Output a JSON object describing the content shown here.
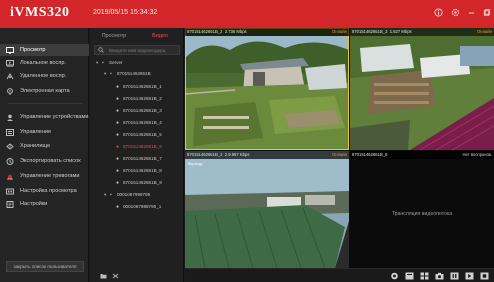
{
  "app": {
    "name": "iVMS320",
    "datetime": "2019/05/15 15:34:32"
  },
  "window_controls": [
    "info-icon",
    "settings-icon",
    "minimize-icon",
    "maximize-icon"
  ],
  "sidebar": {
    "items": [
      {
        "label": "Просмотр",
        "icon": "monitor-icon",
        "active": true
      },
      {
        "label": "Локальное воспр.",
        "icon": "local-playback-icon"
      },
      {
        "label": "Удаленное воспр.",
        "icon": "remote-playback-icon"
      },
      {
        "label": "Электронная карта",
        "icon": "emap-icon"
      },
      {
        "label": "Управление устройствами",
        "icon": "device-management-icon"
      },
      {
        "label": "Управление",
        "icon": "management-icon"
      },
      {
        "label": "Хранилище",
        "icon": "storage-icon"
      },
      {
        "label": "Экспортировать список",
        "icon": "export-list-icon"
      },
      {
        "label": "Управление тревогами",
        "icon": "alarm-management-icon"
      },
      {
        "label": "Настройка просмотра",
        "icon": "view-settings-icon"
      },
      {
        "label": "Настройки",
        "icon": "settings-icon"
      }
    ],
    "user_list_button": "закрыть список пользователя"
  },
  "device_panel": {
    "tabs": [
      "Просмотр",
      "Видео"
    ],
    "active_tab": "Видео",
    "search_placeholder": "Введите имя видеокодера",
    "tree": {
      "root": "Server",
      "groups": [
        {
          "name": "870151462651B",
          "channels": [
            "870151462651B_1",
            "870151462651B_2",
            "870151462651B_3",
            "870151462651B_4",
            "870151462651B_5",
            "870151462651B_6",
            "870151462651B_7",
            "870151462651B_8",
            "870151462651B_9"
          ],
          "selected_channel": "870151462651B_6"
        },
        {
          "name": "0001087989795",
          "channels": [
            "0001087989795_1"
          ]
        }
      ]
    }
  },
  "video_grid": {
    "cams": [
      {
        "title": "870151462651B_2",
        "rate": "3.736 Mbps",
        "status": "Онлайн",
        "focused": true
      },
      {
        "title": "870151462651B_3",
        "rate": "1.627 Mbps",
        "status": "Онлайн"
      },
      {
        "title": "870151462651B_2",
        "rate": "2.9.957 Kbps",
        "status": "Онлайн",
        "osd_label": "Веранда"
      },
      {
        "title": "870151462651B_6",
        "status": "Нет воспроизв.",
        "placeholder": "Трансляция видеопотока"
      }
    ]
  },
  "toolbar": {
    "buttons": [
      "snapshot-icon",
      "layout-1x1-icon",
      "layout-grid-icon",
      "camera-icon",
      "pause-icon",
      "play-icon",
      "stop-icon"
    ]
  },
  "colors": {
    "titlebar": "#d2262b",
    "accent": "#e64a4f",
    "online": "#f39a2f",
    "focus": "#f5c518"
  }
}
